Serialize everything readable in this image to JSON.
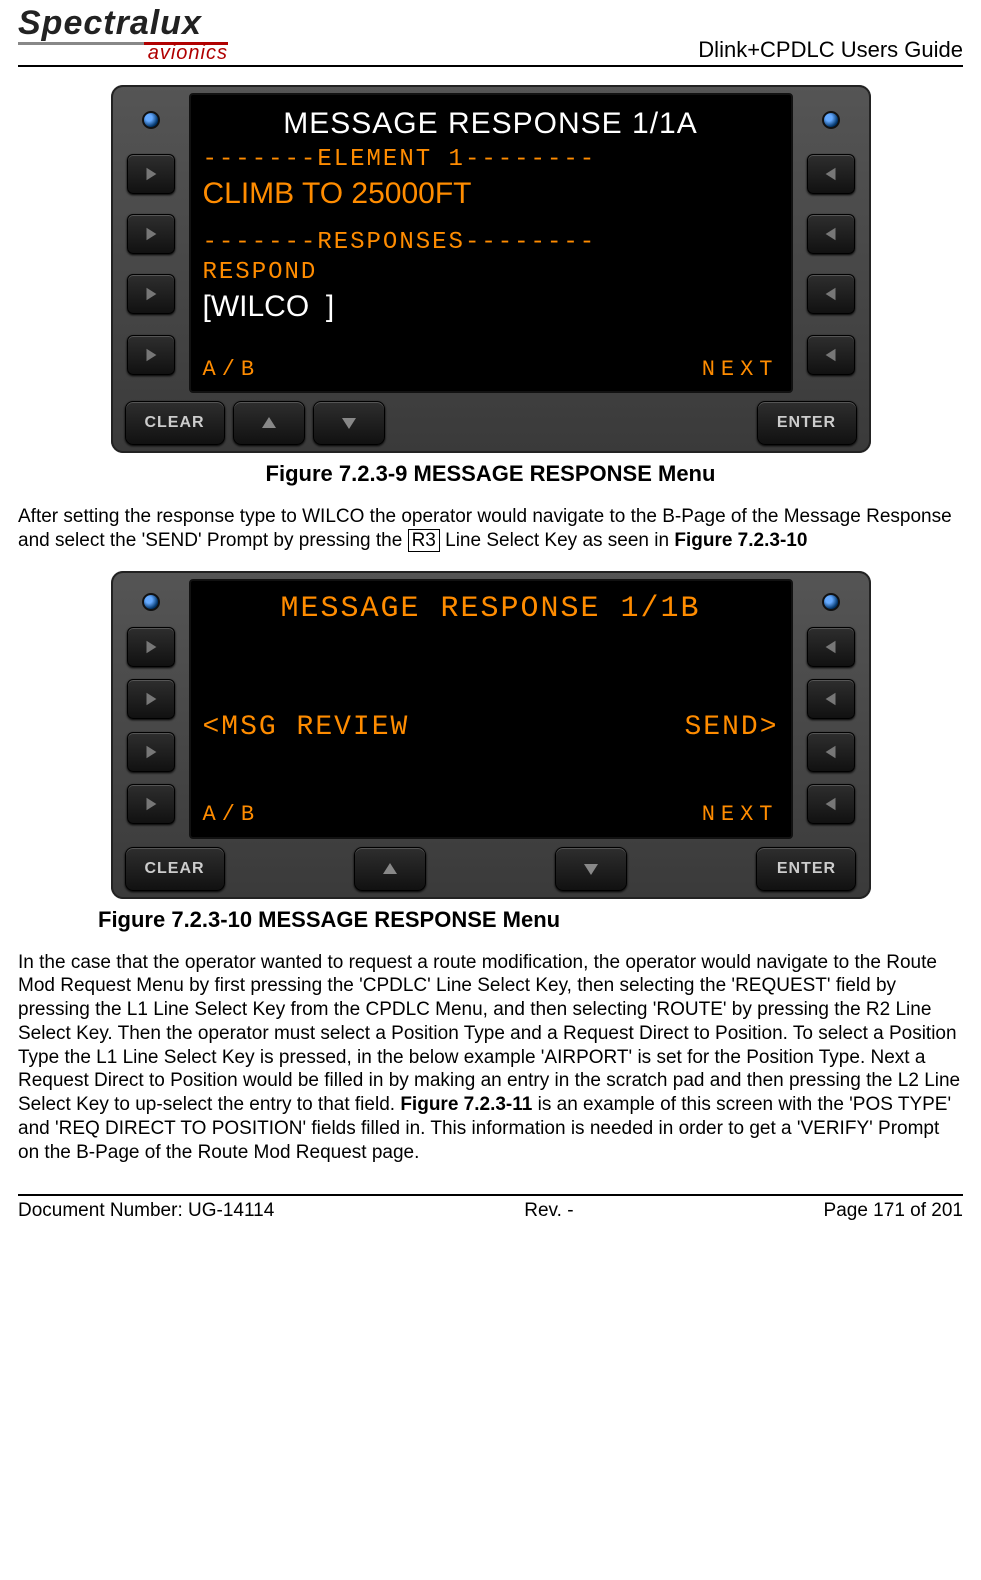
{
  "header": {
    "logo_main": "Spectralux",
    "logo_sub": "avionics",
    "doc_title": "Dlink+CPDLC Users Guide"
  },
  "figure1": {
    "caption": "Figure 7.2.3-9 MESSAGE RESPONSE Menu",
    "screen": {
      "title": "MESSAGE RESPONSE 1/1A",
      "element_header": "-------ELEMENT 1--------",
      "element_value": "CLIMB TO 25000FT",
      "responses_header": "-------RESPONSES--------",
      "respond_label": "RESPOND",
      "respond_value": "[WILCO  ]",
      "bottom_left": "A/B",
      "bottom_right": "NEXT"
    },
    "buttons": {
      "clear": "CLEAR",
      "enter": "ENTER"
    }
  },
  "para1": {
    "t1": "After setting the response type to WILCO the operator would navigate to the B-Page of the Message Response and select the 'SEND' Prompt by pressing the ",
    "key": "R3",
    "t2": " Line Select Key as seen in ",
    "bold": "Figure 7.2.3-10"
  },
  "figure2": {
    "caption": "Figure 7.2.3-10 MESSAGE RESPONSE Menu",
    "screen": {
      "title": "MESSAGE RESPONSE 1/1B",
      "row_left": "<MSG REVIEW",
      "row_right": "SEND>",
      "bottom_left": "A/B",
      "bottom_right": "NEXT"
    },
    "buttons": {
      "clear": "CLEAR",
      "enter": "ENTER"
    }
  },
  "para2": {
    "t1": "In the case that the operator wanted to request a route modification, the operator would navigate to the Route Mod Request Menu by first pressing the 'CPDLC' Line Select Key, then selecting the 'REQUEST' field by pressing the L1 Line Select Key from the CPDLC Menu, and then selecting 'ROUTE' by pressing the R2 Line Select Key.  Then the operator must select a Position Type and a Request Direct to Position.  To select a Position Type the L1 Line Select Key is pressed, in the below example 'AIRPORT' is set for the Position Type.  Next a Request Direct to Position would be filled in by making an entry in the scratch pad and then pressing the L2 Line Select Key to up-select the entry to that field.  ",
    "bold": "Figure 7.2.3-11",
    "t2": " is an example of this screen with the 'POS TYPE' and 'REQ DIRECT TO POSITION' fields filled in. This information is needed in order to get a 'VERIFY' Prompt on the B-Page of the Route Mod Request page."
  },
  "footer": {
    "docnum": "Document Number:  UG-14114",
    "rev": "Rev. -",
    "page": "Page 171 of 201"
  }
}
